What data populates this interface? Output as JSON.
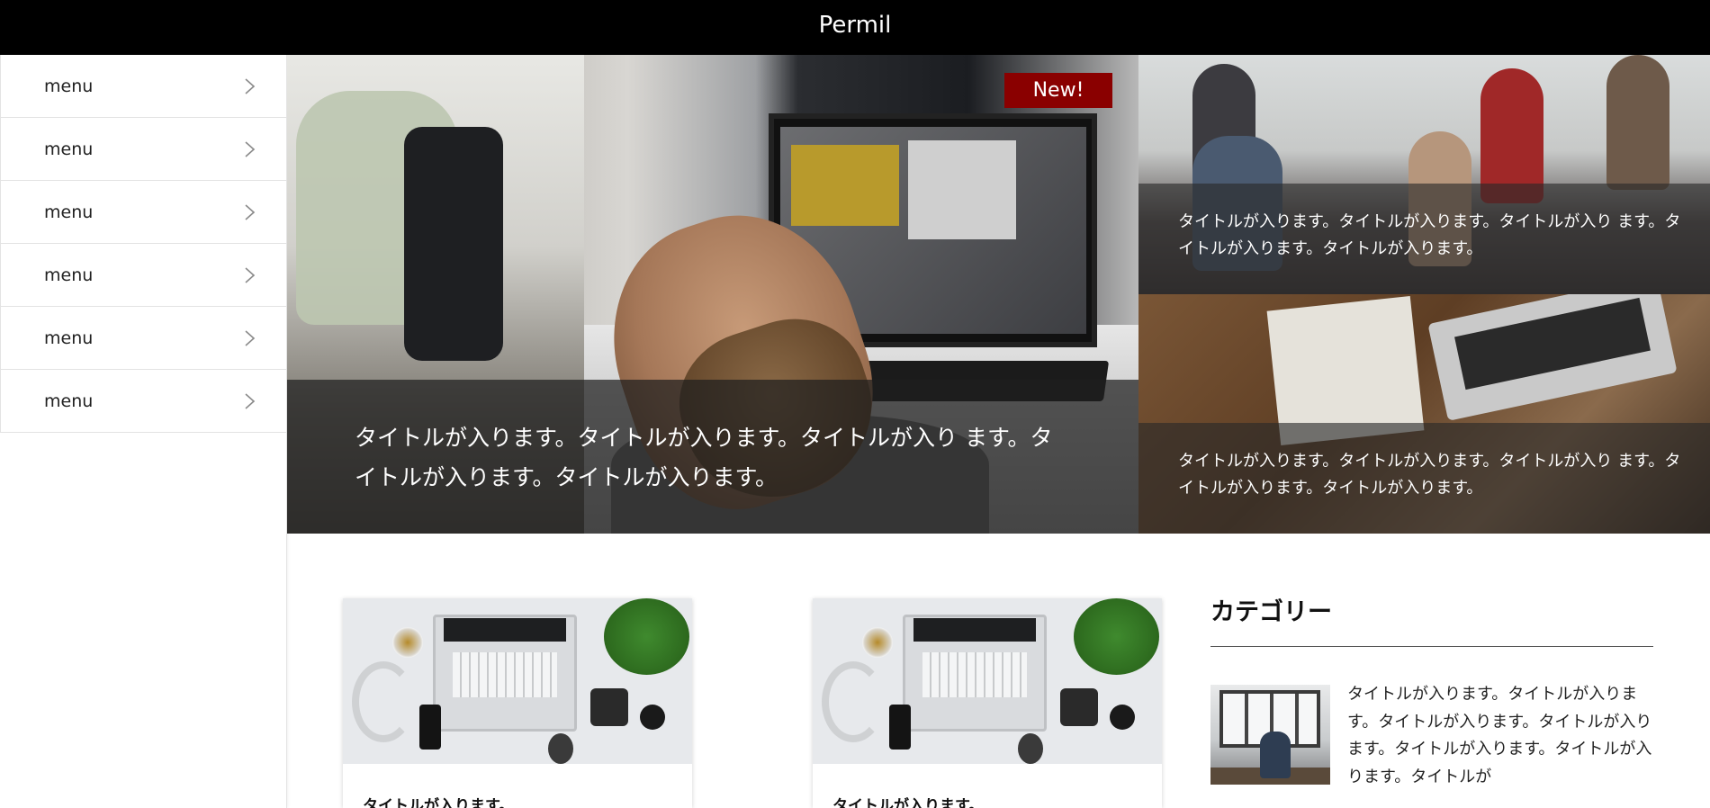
{
  "header": {
    "brand": "Permil"
  },
  "sidebar": {
    "items": [
      {
        "label": "menu"
      },
      {
        "label": "menu"
      },
      {
        "label": "menu"
      },
      {
        "label": "menu"
      },
      {
        "label": "menu"
      },
      {
        "label": "menu"
      }
    ]
  },
  "hero": {
    "badge": "New!",
    "main_caption": "タイトルが入ります。タイトルが入ります。タイトルが入り ます。タイトルが入ります。タイトルが入ります。",
    "side": [
      {
        "caption": "タイトルが入ります。タイトルが入ります。タイトルが入り ます。タイトルが入ります。タイトルが入ります。"
      },
      {
        "caption": "タイトルが入ります。タイトルが入ります。タイトルが入り ます。タイトルが入ります。タイトルが入ります。"
      }
    ]
  },
  "cards": [
    {
      "title": "タイトルが入ります。"
    },
    {
      "title": "タイトルが入ります。"
    }
  ],
  "category": {
    "heading": "カテゴリー",
    "entry_text": "タイトルが入ります。タイトルが入ります。タイトルが入ります。タイトルが入ります。タイトルが入ります。タイトルが入ります。タイトルが"
  },
  "colors": {
    "header_bg": "#000000",
    "badge_bg": "#8a0000",
    "caption_overlay": "#1e1e1e"
  }
}
